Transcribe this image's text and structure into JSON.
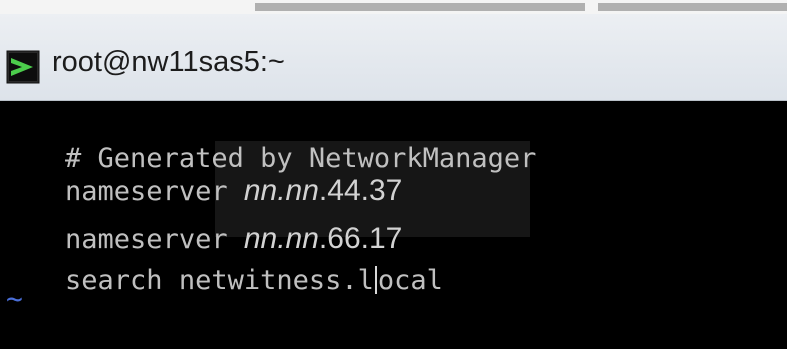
{
  "window": {
    "title": "root@nw11sas5:~",
    "icon": "putty-terminal-icon"
  },
  "terminal": {
    "comment": "# Generated by NetworkManager",
    "ns1": {
      "keyword": "nameserver ",
      "ip_a": "nn.nn",
      "ip_b": ".44.37"
    },
    "ns2": {
      "keyword": "nameserver ",
      "ip_a": "nn.nn",
      "ip_b": ".66.17"
    },
    "search": {
      "before_cursor": "search netwitness.l",
      "after_cursor": "ocal"
    },
    "empty_line_marker": "~"
  },
  "colors": {
    "terminal_bg": "#000000",
    "terminal_fg": "#c0c0c0",
    "tilde": "#4a6ed8"
  }
}
